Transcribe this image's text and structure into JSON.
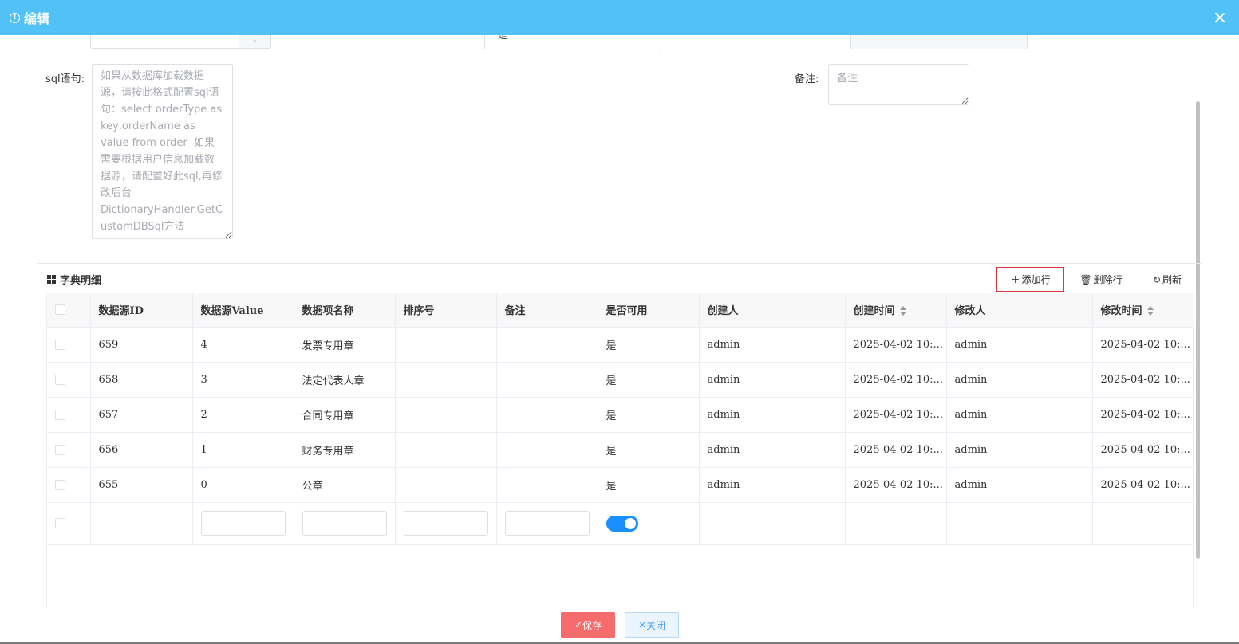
{
  "dialog": {
    "title": "编辑"
  },
  "form": {
    "status_value": "是",
    "sql_label": "sql语句:",
    "sql_placeholder": "如果从数据库加载数据源，请按此格式配置sql语句：select orderType as key,orderName as value from order  如果需要根据用户信息加载数据源，请配置好此sql,再修改后台DictionaryHandler.GetCustomDBSql方法",
    "remark_label": "备注:",
    "remark_placeholder": "备注"
  },
  "detail": {
    "title": "字典明细",
    "add_label": "添加行",
    "delete_label": "删除行",
    "refresh_label": "刷新",
    "columns": [
      "数据源ID",
      "数据源Value",
      "数据项名称",
      "排序号",
      "备注",
      "是否可用",
      "创建人",
      "创建时间",
      "修改人",
      "修改时间"
    ],
    "rows": [
      {
        "id": "659",
        "value": "4",
        "name": "发票专用章",
        "sort": "",
        "remark": "",
        "enabled": "是",
        "creator": "admin",
        "created": "2025-04-02 10:...",
        "modifier": "admin",
        "modified": "2025-04-02 10:..."
      },
      {
        "id": "658",
        "value": "3",
        "name": "法定代表人章",
        "sort": "",
        "remark": "",
        "enabled": "是",
        "creator": "admin",
        "created": "2025-04-02 10:...",
        "modifier": "admin",
        "modified": "2025-04-02 10:..."
      },
      {
        "id": "657",
        "value": "2",
        "name": "合同专用章",
        "sort": "",
        "remark": "",
        "enabled": "是",
        "creator": "admin",
        "created": "2025-04-02 10:...",
        "modifier": "admin",
        "modified": "2025-04-02 10:..."
      },
      {
        "id": "656",
        "value": "1",
        "name": "财务专用章",
        "sort": "",
        "remark": "",
        "enabled": "是",
        "creator": "admin",
        "created": "2025-04-02 10:...",
        "modifier": "admin",
        "modified": "2025-04-02 10:..."
      },
      {
        "id": "655",
        "value": "0",
        "name": "公章",
        "sort": "",
        "remark": "",
        "enabled": "是",
        "creator": "admin",
        "created": "2025-04-02 10:...",
        "modifier": "admin",
        "modified": "2025-04-02 10:..."
      }
    ],
    "new_row_enabled": true
  },
  "footer": {
    "save_label": "保存",
    "close_label": "关闭"
  },
  "colors": {
    "header": "#52c1f5",
    "save": "#f56c6c",
    "switch": "#1890ff"
  },
  "icons": {
    "title": "info-icon",
    "close": "close-icon",
    "detail": "grid-icon",
    "add": "plus-icon",
    "delete": "trash-icon",
    "refresh": "refresh-icon",
    "save": "check-icon",
    "close_btn": "x-icon"
  }
}
